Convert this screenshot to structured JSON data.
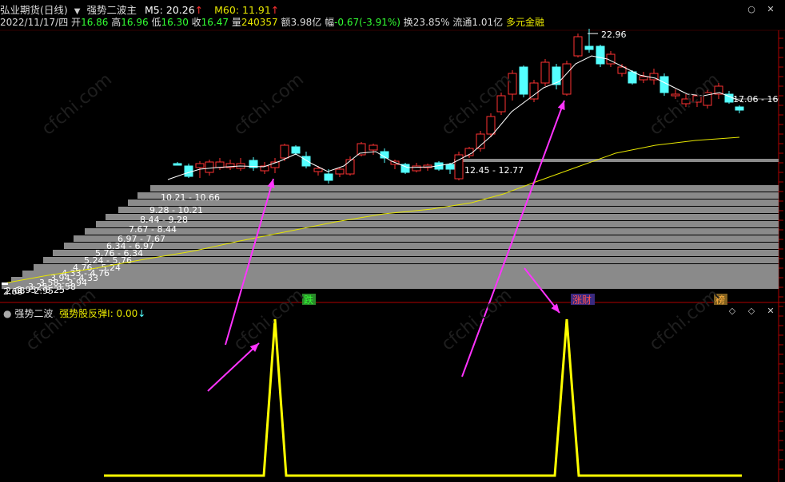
{
  "header": {
    "stock_name": "弘业期货(日线)",
    "indicator_name": "强势二波主",
    "m5_label": "M5: 20.26",
    "m60_label": "M60: 11.91",
    "date": "2022/11/17/四",
    "open_label": "开",
    "open_value": "16.86",
    "high_label": "高",
    "high_value": "16.96",
    "low_label": "低",
    "low_value": "16.30",
    "close_label": "收",
    "close_value": "16.47",
    "volume_label": "量",
    "volume_value": "240357",
    "amount": "额3.98亿",
    "change_label": "幅",
    "change_value": "-0.67(-3.91%)",
    "turnover": "换23.85%",
    "float": "流通1.01亿",
    "tag": "多元金融"
  },
  "colors": {
    "up": "#ff3232",
    "down": "#54ffff",
    "ma_short": "#ffffff",
    "ma_long": "#e6e600",
    "profile_bar": "#8a8a8a",
    "arrow": "#ff33ff",
    "signal": "#ffff00",
    "frame": "#b00000"
  },
  "main": {
    "high_annotation": "22.96",
    "right_price_label": "17.06 - 16",
    "zone_labels": [
      "12.45 - 12.77",
      "10.21 - 10.66",
      "9.28 - 10.21",
      "8.44 - 9.28",
      "7.67 - 8.44",
      "6.97 - 7.67",
      "6.34 - 6.97",
      "5.76 - 6.34",
      "5.24 - 5.76",
      "4.76 - 5.24",
      "4.33 - 4.76",
      "3.94 - 4.33",
      "3.58 - 3.94",
      "3.25 - 3.58",
      "2.95 - 3.25",
      "2.68 - 2.95"
    ],
    "low_annotation": "2.68",
    "event_tags": [
      "跌",
      "涨财",
      "榜"
    ]
  },
  "sub": {
    "title": "强势二波",
    "signal_label": "强势股反弹I: 0.00"
  },
  "watermark": "cfchi.com"
}
